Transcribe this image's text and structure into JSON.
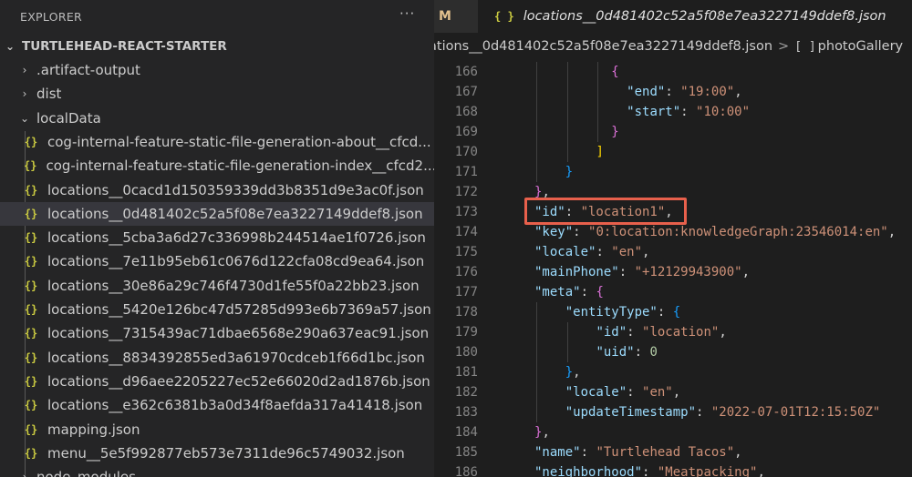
{
  "sidebar": {
    "title": "EXPLORER",
    "more": "···",
    "project": "TURTLEHEAD-REACT-STARTER",
    "items": [
      {
        "label": ".artifact-output",
        "kind": "folder",
        "expanded": false
      },
      {
        "label": "dist",
        "kind": "folder",
        "expanded": false
      },
      {
        "label": "localData",
        "kind": "folder",
        "expanded": true
      },
      {
        "label": "cog-internal-feature-static-file-generation-about__cfcd...",
        "kind": "json"
      },
      {
        "label": "cog-internal-feature-static-file-generation-index__cfcd2...",
        "kind": "json"
      },
      {
        "label": "locations__0cacd1d150359339dd3b8351d9e3ac0f.json",
        "kind": "json"
      },
      {
        "label": "locations__0d481402c52a5f08e7ea3227149ddef8.json",
        "kind": "json",
        "selected": true
      },
      {
        "label": "locations__5cba3a6d27c336998b244514ae1f0726.json",
        "kind": "json"
      },
      {
        "label": "locations__7e11b95eb61c0676d122cfa08cd9ea64.json",
        "kind": "json"
      },
      {
        "label": "locations__30e86a29c746f4730d1fe55f0a22bb23.json",
        "kind": "json"
      },
      {
        "label": "locations__5420e126bc47d57285d993e6b7369a57.json",
        "kind": "json"
      },
      {
        "label": "locations__7315439ac71dbae6568e290a637eac91.json",
        "kind": "json"
      },
      {
        "label": "locations__8834392855ed3a61970cdceb1f66d1bc.json",
        "kind": "json"
      },
      {
        "label": "locations__d96aee2205227ec52e66020d2ad1876b.json",
        "kind": "json"
      },
      {
        "label": "locations__e362c6381b3a0d34f8aefda317a41418.json",
        "kind": "json"
      },
      {
        "label": "mapping.json",
        "kind": "json"
      },
      {
        "label": "menu__5e5f992877eb573e7311de96c5749032.json",
        "kind": "json"
      },
      {
        "label": "node_modules",
        "kind": "folder",
        "expanded": false
      }
    ]
  },
  "editor": {
    "prev_tab": "M",
    "tab_icon": "{ }",
    "tab_label": "locations__0d481402c52a5f08e7ea3227149ddef8.json",
    "breadcrumb": {
      "file": "ations__0d481402c52a5f08e7ea3227149ddef8.json",
      "separator": ">",
      "symbol_icon": "[ ]",
      "symbol": "photoGallery"
    },
    "lines": [
      {
        "num": "166",
        "indent": 7,
        "tokens": [
          {
            "t": "{",
            "c": "b2"
          }
        ]
      },
      {
        "num": "167",
        "indent": 8,
        "tokens": [
          {
            "t": "\"end\"",
            "c": "k"
          },
          {
            "t": ": ",
            "c": "p"
          },
          {
            "t": "\"19:00\"",
            "c": "s"
          },
          {
            "t": ",",
            "c": "p"
          }
        ]
      },
      {
        "num": "168",
        "indent": 8,
        "tokens": [
          {
            "t": "\"start\"",
            "c": "k"
          },
          {
            "t": ": ",
            "c": "p"
          },
          {
            "t": "\"10:00\"",
            "c": "s"
          }
        ]
      },
      {
        "num": "169",
        "indent": 7,
        "tokens": [
          {
            "t": "}",
            "c": "b2"
          }
        ]
      },
      {
        "num": "170",
        "indent": 6,
        "tokens": [
          {
            "t": "]",
            "c": "b1"
          }
        ]
      },
      {
        "num": "171",
        "indent": 4,
        "tokens": [
          {
            "t": "}",
            "c": "b3"
          }
        ]
      },
      {
        "num": "172",
        "indent": 2,
        "tokens": [
          {
            "t": "}",
            "c": "b2"
          },
          {
            "t": ",",
            "c": "p"
          }
        ]
      },
      {
        "num": "173",
        "indent": 2,
        "tokens": [
          {
            "t": "\"id\"",
            "c": "k"
          },
          {
            "t": ": ",
            "c": "p"
          },
          {
            "t": "\"location1\"",
            "c": "s"
          },
          {
            "t": ",",
            "c": "p"
          }
        ]
      },
      {
        "num": "174",
        "indent": 2,
        "tokens": [
          {
            "t": "\"key\"",
            "c": "k"
          },
          {
            "t": ": ",
            "c": "p"
          },
          {
            "t": "\"0:location:knowledgeGraph:23546014:en\"",
            "c": "s"
          },
          {
            "t": ",",
            "c": "p"
          }
        ]
      },
      {
        "num": "175",
        "indent": 2,
        "tokens": [
          {
            "t": "\"locale\"",
            "c": "k"
          },
          {
            "t": ": ",
            "c": "p"
          },
          {
            "t": "\"en\"",
            "c": "s"
          },
          {
            "t": ",",
            "c": "p"
          }
        ]
      },
      {
        "num": "176",
        "indent": 2,
        "tokens": [
          {
            "t": "\"mainPhone\"",
            "c": "k"
          },
          {
            "t": ": ",
            "c": "p"
          },
          {
            "t": "\"+12129943900\"",
            "c": "s"
          },
          {
            "t": ",",
            "c": "p"
          }
        ]
      },
      {
        "num": "177",
        "indent": 2,
        "tokens": [
          {
            "t": "\"meta\"",
            "c": "k"
          },
          {
            "t": ": ",
            "c": "p"
          },
          {
            "t": "{",
            "c": "b2"
          }
        ]
      },
      {
        "num": "178",
        "indent": 4,
        "tokens": [
          {
            "t": "\"entityType\"",
            "c": "k"
          },
          {
            "t": ": ",
            "c": "p"
          },
          {
            "t": "{",
            "c": "b3"
          }
        ]
      },
      {
        "num": "179",
        "indent": 6,
        "tokens": [
          {
            "t": "\"id\"",
            "c": "k"
          },
          {
            "t": ": ",
            "c": "p"
          },
          {
            "t": "\"location\"",
            "c": "s"
          },
          {
            "t": ",",
            "c": "p"
          }
        ]
      },
      {
        "num": "180",
        "indent": 6,
        "tokens": [
          {
            "t": "\"uid\"",
            "c": "k"
          },
          {
            "t": ": ",
            "c": "p"
          },
          {
            "t": "0",
            "c": "n"
          }
        ]
      },
      {
        "num": "181",
        "indent": 4,
        "tokens": [
          {
            "t": "}",
            "c": "b3"
          },
          {
            "t": ",",
            "c": "p"
          }
        ]
      },
      {
        "num": "182",
        "indent": 4,
        "tokens": [
          {
            "t": "\"locale\"",
            "c": "k"
          },
          {
            "t": ": ",
            "c": "p"
          },
          {
            "t": "\"en\"",
            "c": "s"
          },
          {
            "t": ",",
            "c": "p"
          }
        ]
      },
      {
        "num": "183",
        "indent": 4,
        "tokens": [
          {
            "t": "\"updateTimestamp\"",
            "c": "k"
          },
          {
            "t": ": ",
            "c": "p"
          },
          {
            "t": "\"2022-07-01T12:15:50Z\"",
            "c": "s"
          }
        ]
      },
      {
        "num": "184",
        "indent": 2,
        "tokens": [
          {
            "t": "}",
            "c": "b2"
          },
          {
            "t": ",",
            "c": "p"
          }
        ]
      },
      {
        "num": "185",
        "indent": 2,
        "tokens": [
          {
            "t": "\"name\"",
            "c": "k"
          },
          {
            "t": ": ",
            "c": "p"
          },
          {
            "t": "\"Turtlehead Tacos\"",
            "c": "s"
          },
          {
            "t": ",",
            "c": "p"
          }
        ]
      },
      {
        "num": "186",
        "indent": 2,
        "tokens": [
          {
            "t": "\"neighborhood\"",
            "c": "k"
          },
          {
            "t": ": ",
            "c": "p"
          },
          {
            "t": "\"Meatpacking\"",
            "c": "s"
          },
          {
            "t": ",",
            "c": "p"
          }
        ]
      }
    ],
    "highlighted_line": "173"
  },
  "colors": {
    "background": "#1e1e1e",
    "sidebar": "#252526",
    "selection": "#37373d",
    "json_icon": "#cbcb41",
    "key": "#9cdcfe",
    "string": "#ce9178",
    "number": "#b5cea8",
    "highlight_box": "#e8604c"
  }
}
